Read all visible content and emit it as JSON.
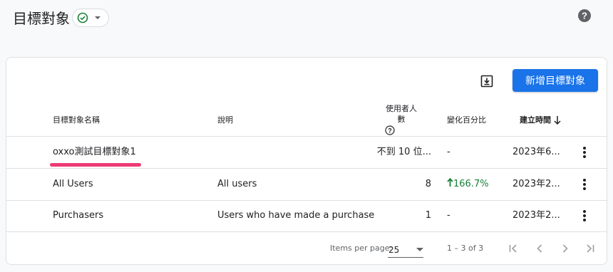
{
  "header": {
    "title": "目標對象",
    "status_icon": "check-circle-icon",
    "status_color": "#188038",
    "help_icon": "help-icon"
  },
  "toolbar": {
    "download_icon": "download-icon",
    "create_label": "新增目標對象",
    "accent": "#1a73e8"
  },
  "table": {
    "columns": {
      "name": "目標對象名稱",
      "description": "說明",
      "users": "使用者人數",
      "change": "變化百分比",
      "created": "建立時間",
      "created_sort": "arrow-down-icon"
    },
    "rows": [
      {
        "name": "oxxo測試目標對象1",
        "description": "",
        "users": "不到 10 位...",
        "change": "-",
        "created": "2023年6..."
      },
      {
        "name": "All Users",
        "description": "All users",
        "users": "8",
        "change": "166.7%",
        "change_dir": "up",
        "created": "2023年2..."
      },
      {
        "name": "Purchasers",
        "description": "Users who have made a purchase",
        "users": "1",
        "change": "-",
        "created": "2023年2..."
      }
    ]
  },
  "pagination": {
    "items_per_page_label": "Items per page:",
    "page_size": "25",
    "range": "1 – 3 of 3"
  }
}
